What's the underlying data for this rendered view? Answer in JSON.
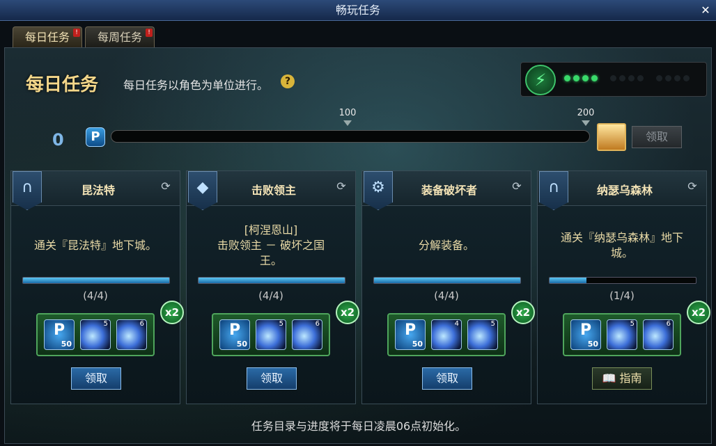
{
  "window": {
    "title": "畅玩任务",
    "close_icon": "close-icon"
  },
  "tabs": [
    {
      "label": "每日任务",
      "alert": "!"
    },
    {
      "label": "每周任务",
      "alert": "!"
    }
  ],
  "header": {
    "title": "每日任务",
    "subtitle": "每日任务以角色为单位进行。",
    "help": "?"
  },
  "energy": {
    "dots_on": 4,
    "dots_total": 12
  },
  "progress": {
    "points": "0",
    "badge": "P",
    "fraction": 0.0,
    "milestones": [
      "100",
      "200"
    ],
    "claim_label": "领取"
  },
  "cards": [
    {
      "title": "昆法特",
      "desc": "通关『昆法特』地下城。",
      "count": "(4/4)",
      "fraction": 1.0,
      "multiplier": "x2",
      "rewards": [
        {
          "label": "P",
          "qty": "50"
        },
        {
          "qty": "5"
        },
        {
          "qty": "6"
        }
      ],
      "button": "领取"
    },
    {
      "title": "击败领主",
      "desc": "[柯涅恩山]\n击败领主 － 破坏之国\n王。",
      "count": "(4/4)",
      "fraction": 1.0,
      "multiplier": "x2",
      "rewards": [
        {
          "label": "P",
          "qty": "50"
        },
        {
          "qty": "5"
        },
        {
          "qty": "6"
        }
      ],
      "button": "领取"
    },
    {
      "title": "装备破坏者",
      "desc": "分解装备。",
      "count": "(4/4)",
      "fraction": 1.0,
      "multiplier": "x2",
      "rewards": [
        {
          "label": "P",
          "qty": "50"
        },
        {
          "qty": "4"
        },
        {
          "qty": "5"
        }
      ],
      "button": "领取"
    },
    {
      "title": "纳瑟乌森林",
      "desc": "通关『纳瑟乌森林』地下\n城。",
      "count": "(1/4)",
      "fraction": 0.25,
      "multiplier": "x2",
      "rewards": [
        {
          "label": "P",
          "qty": "50"
        },
        {
          "qty": "5"
        },
        {
          "qty": "6"
        }
      ],
      "button": "指南"
    }
  ],
  "footer": "任务目录与进度将于每日凌晨06点初始化。"
}
